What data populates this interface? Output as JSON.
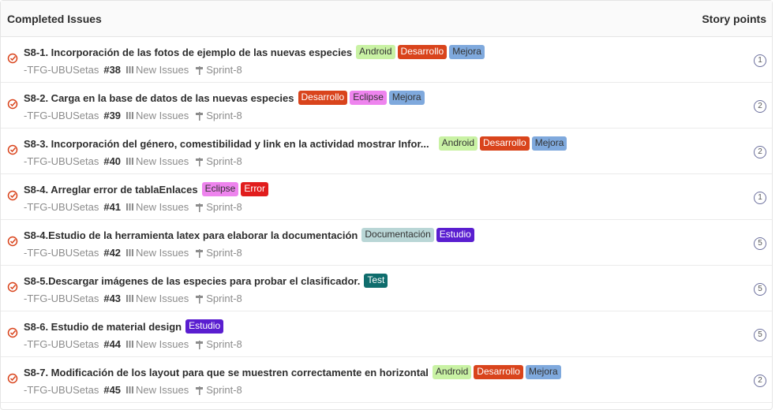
{
  "header": {
    "title": "Completed Issues",
    "points_label": "Story points"
  },
  "colors": {
    "android": "#c9f2a4",
    "desarrollo": "#d9441c",
    "mejora": "#7fa9dd",
    "eclipse": "#ee84ee",
    "error": "#e11d1d",
    "documentacion": "#b9d6d6",
    "estudio": "#5a1ed0",
    "test": "#0f6d6d"
  },
  "issues": [
    {
      "title": "S8-1. Incorporación de las fotos de ejemplo de las nuevas especies",
      "project": "-TFG-UBUSetas",
      "ref": "#38",
      "board": "New Issues",
      "milestone": "Sprint-8",
      "points": "1",
      "labels": [
        "Android",
        "Desarrollo",
        "Mejora"
      ]
    },
    {
      "title": "S8-2. Carga en la base de datos de las nuevas especies",
      "project": "-TFG-UBUSetas",
      "ref": "#39",
      "board": "New Issues",
      "milestone": "Sprint-8",
      "points": "2",
      "labels": [
        "Desarrollo",
        "Eclipse",
        "Mejora"
      ]
    },
    {
      "title": "S8-3. Incorporación del género, comestibilidad y link en la actividad mostrar Infor...",
      "project": "-TFG-UBUSetas",
      "ref": "#40",
      "board": "New Issues",
      "milestone": "Sprint-8",
      "points": "2",
      "labels": [
        "Android",
        "Desarrollo",
        "Mejora"
      ]
    },
    {
      "title": "S8-4. Arreglar error de tablaEnlaces",
      "project": "-TFG-UBUSetas",
      "ref": "#41",
      "board": "New Issues",
      "milestone": "Sprint-8",
      "points": "1",
      "labels": [
        "Eclipse",
        "Error"
      ]
    },
    {
      "title": "S8-4.Estudio de la herramienta latex para elaborar la documentación",
      "project": "-TFG-UBUSetas",
      "ref": "#42",
      "board": "New Issues",
      "milestone": "Sprint-8",
      "points": "5",
      "labels": [
        "Documentación",
        "Estudio"
      ]
    },
    {
      "title": "S8-5.Descargar imágenes de las especies para probar el clasificador.",
      "project": "-TFG-UBUSetas",
      "ref": "#43",
      "board": "New Issues",
      "milestone": "Sprint-8",
      "points": "5",
      "labels": [
        "Test"
      ]
    },
    {
      "title": "S8-6. Estudio de material design",
      "project": "-TFG-UBUSetas",
      "ref": "#44",
      "board": "New Issues",
      "milestone": "Sprint-8",
      "points": "5",
      "labels": [
        "Estudio"
      ]
    },
    {
      "title": "S8-7. Modificación de los layout para que se muestren correctamente en horizontal",
      "project": "-TFG-UBUSetas",
      "ref": "#45",
      "board": "New Issues",
      "milestone": "Sprint-8",
      "points": "2",
      "labels": [
        "Android",
        "Desarrollo",
        "Mejora"
      ]
    }
  ]
}
